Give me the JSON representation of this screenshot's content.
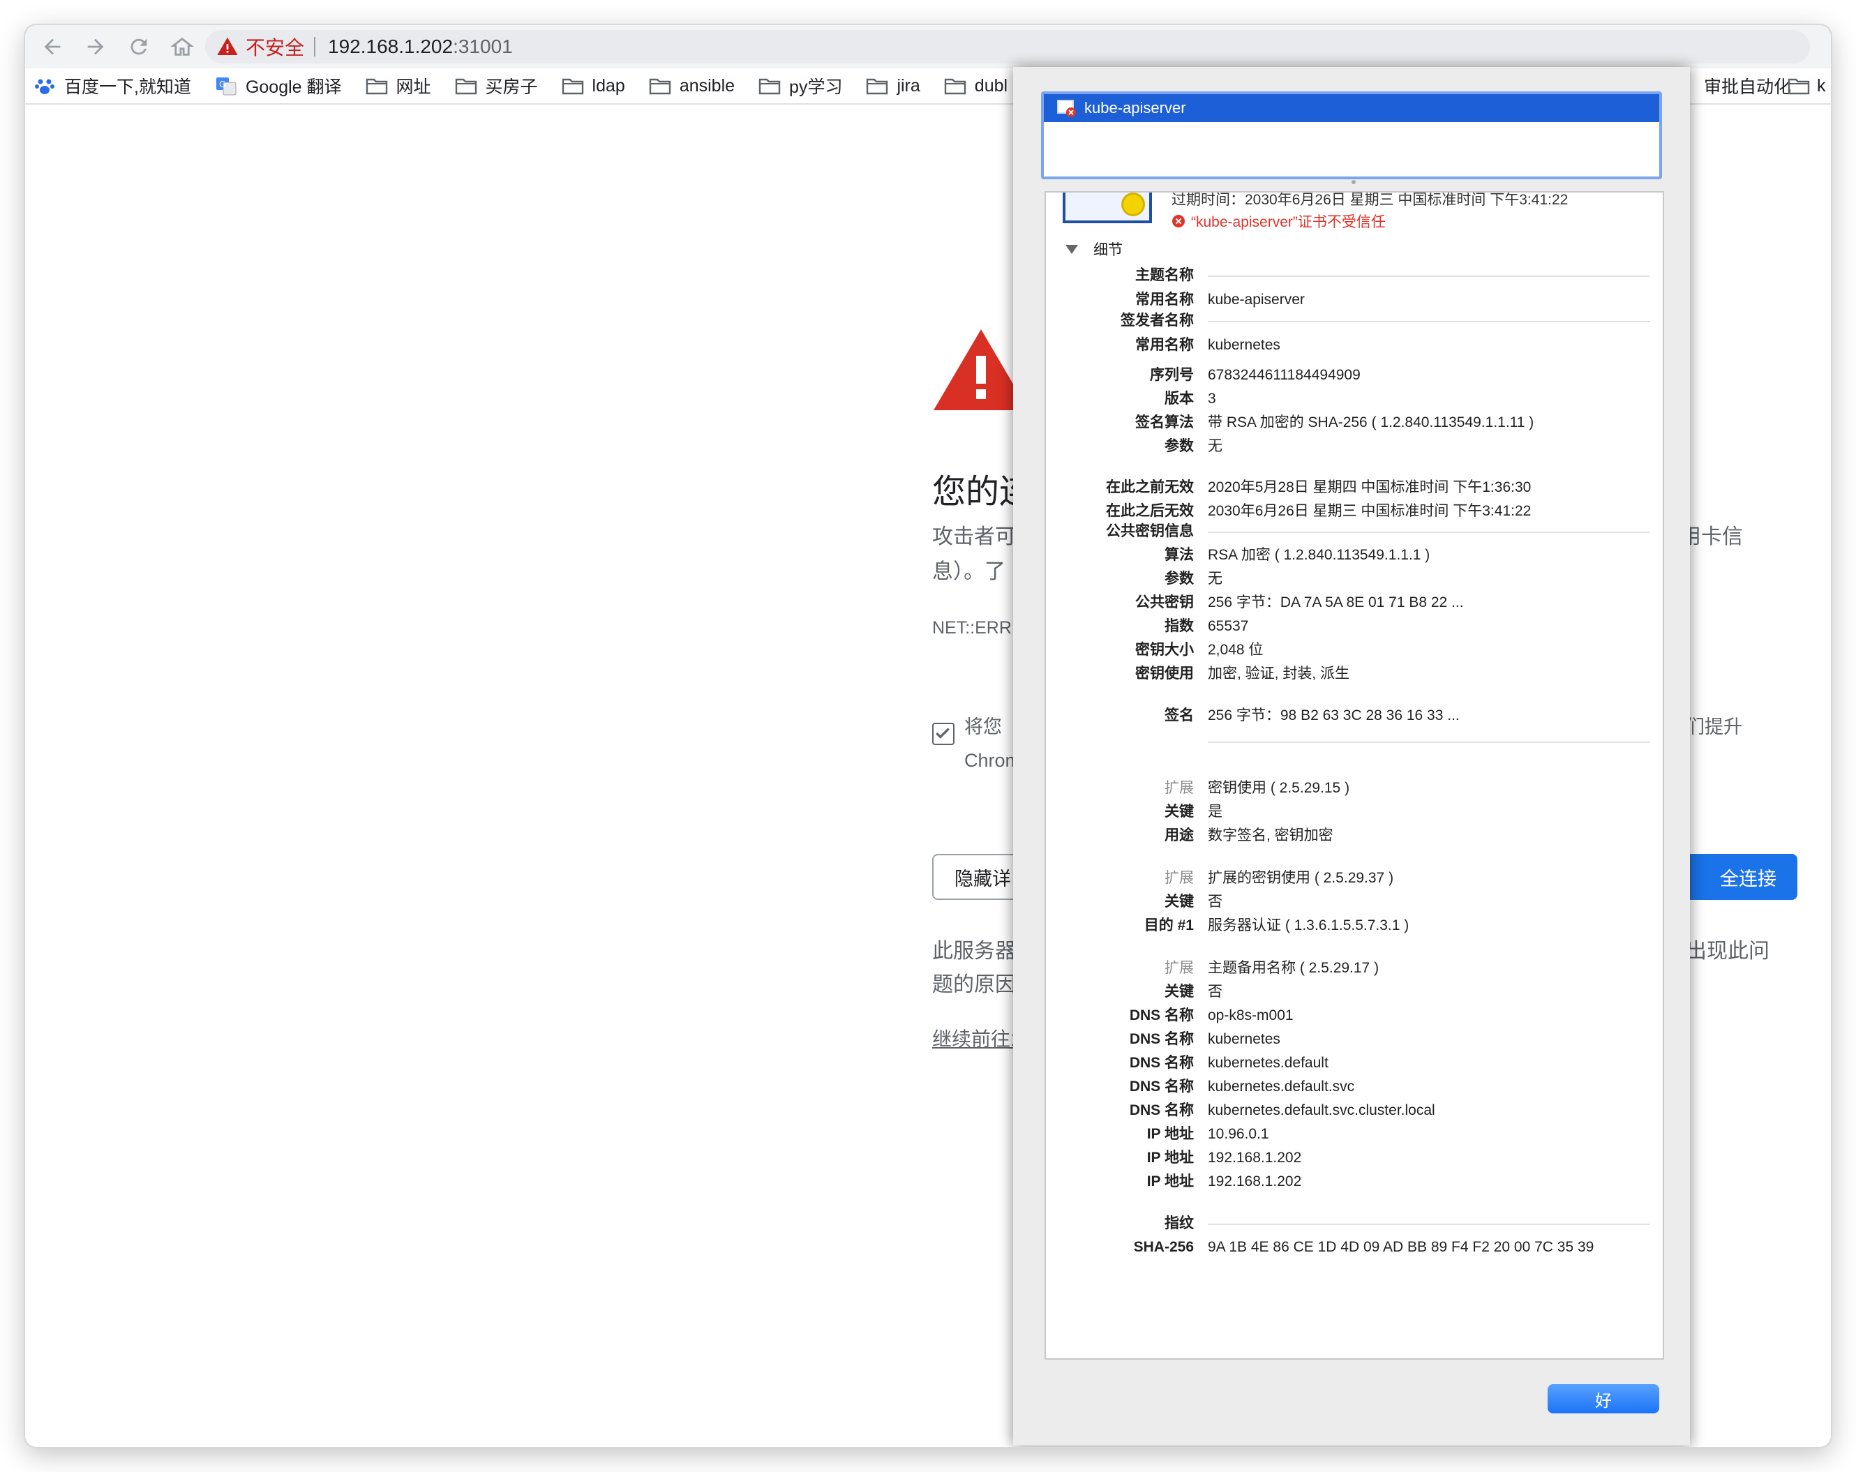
{
  "toolbar": {
    "security_label": "不安全",
    "url_host": "192.168.1.202",
    "url_port": ":31001"
  },
  "bookmarks": {
    "items": [
      {
        "label": "百度一下,就知道",
        "icon": "baidu-paw-icon"
      },
      {
        "label": "Google 翻译",
        "icon": "google-translate-icon"
      },
      {
        "label": "网址",
        "icon": "folder-icon"
      },
      {
        "label": "买房子",
        "icon": "folder-icon"
      },
      {
        "label": "ldap",
        "icon": "folder-icon"
      },
      {
        "label": "ansible",
        "icon": "folder-icon"
      },
      {
        "label": "py学习",
        "icon": "folder-icon"
      },
      {
        "label": "jira",
        "icon": "folder-icon"
      },
      {
        "label": "dubl",
        "icon": "folder-icon"
      }
    ],
    "right_partial": "审批自动化",
    "right_last": "k"
  },
  "page": {
    "title_partial": "您的连",
    "line1_left": "攻击者可",
    "line1_right": "用卡信",
    "line2_left": "息）。了",
    "error_code": "NET::ERR",
    "report_left": "将您",
    "report_right": "们提升",
    "report_line2": "Chrom",
    "hide_button": "隐藏详",
    "back_button": "全连接",
    "explain_left1": "此服务器",
    "explain_right1": "出现此问",
    "explain_left2": "题的原因",
    "proceed_link": "继续前往1"
  },
  "sheet": {
    "cert_name": "kube-apiserver",
    "expiry_line": "过期时间：2030年6月26日 星期三 中国标准时间 下午3:41:22",
    "untrusted": "“kube-apiserver”证书不受信任",
    "details_label": "细节",
    "ok_button": "好",
    "rows": [
      {
        "label": "主题名称",
        "section": true
      },
      {
        "label": "常用名称",
        "value": "kube-apiserver"
      },
      {
        "label": "签发者名称",
        "section": true
      },
      {
        "label": "常用名称",
        "value": "kubernetes"
      },
      {
        "label": "序列号",
        "value": "6783244611184494909"
      },
      {
        "label": "版本",
        "value": "3"
      },
      {
        "label": "签名算法",
        "value": "带 RSA 加密的 SHA-256 ( 1.2.840.113549.1.1.11 )"
      },
      {
        "label": "参数",
        "value": "无"
      },
      {
        "label": "在此之前无效",
        "value": "2020年5月28日 星期四 中国标准时间 下午1:36:30"
      },
      {
        "label": "在此之后无效",
        "value": "2030年6月26日 星期三 中国标准时间 下午3:41:22"
      },
      {
        "label": "公共密钥信息",
        "section": true
      },
      {
        "label": "算法",
        "value": "RSA 加密 ( 1.2.840.113549.1.1.1 )"
      },
      {
        "label": "参数",
        "value": "无"
      },
      {
        "label": "公共密钥",
        "value": "256 字节：DA 7A 5A 8E 01 71 B8 22 ..."
      },
      {
        "label": "指数",
        "value": "65537"
      },
      {
        "label": "密钥大小",
        "value": "2,048 位"
      },
      {
        "label": "密钥使用",
        "value": "加密, 验证, 封装, 派生"
      },
      {
        "label": "签名",
        "value": "256 字节：98 B2 63 3C 28 36 16 33 ..."
      },
      {
        "label": "扩展",
        "value": "密钥使用 ( 2.5.29.15 )",
        "gray": true
      },
      {
        "label": "关键",
        "value": "是"
      },
      {
        "label": "用途",
        "value": "数字签名, 密钥加密"
      },
      {
        "label": "扩展",
        "value": "扩展的密钥使用 ( 2.5.29.37 )",
        "gray": true
      },
      {
        "label": "关键",
        "value": "否"
      },
      {
        "label": "目的 #1",
        "value": "服务器认证 ( 1.3.6.1.5.5.7.3.1 )"
      },
      {
        "label": "扩展",
        "value": "主题备用名称 ( 2.5.29.17 )",
        "gray": true
      },
      {
        "label": "关键",
        "value": "否"
      },
      {
        "label": "DNS 名称",
        "value": "op-k8s-m001"
      },
      {
        "label": "DNS 名称",
        "value": "kubernetes"
      },
      {
        "label": "DNS 名称",
        "value": "kubernetes.default"
      },
      {
        "label": "DNS 名称",
        "value": "kubernetes.default.svc"
      },
      {
        "label": "DNS 名称",
        "value": "kubernetes.default.svc.cluster.local"
      },
      {
        "label": "IP 地址",
        "value": "10.96.0.1"
      },
      {
        "label": "IP 地址",
        "value": "192.168.1.202"
      },
      {
        "label": "IP 地址",
        "value": "192.168.1.202"
      },
      {
        "label": "指纹",
        "section": true
      },
      {
        "label": "SHA-256",
        "value": "9A 1B 4E 86 CE 1D 4D 09 AD BB 89 F4 F2 20 00 7C 35 39"
      }
    ]
  }
}
